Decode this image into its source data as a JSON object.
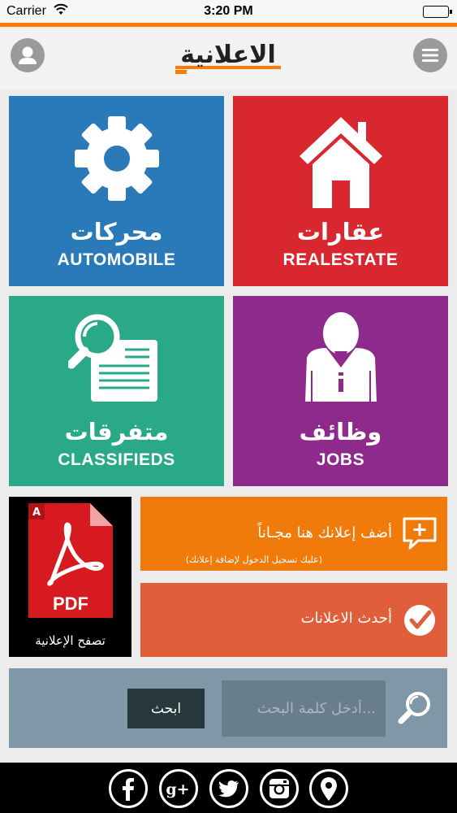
{
  "status_bar": {
    "carrier": "Carrier",
    "time": "3:20 PM"
  },
  "header": {
    "logo_text": "الاعلانية"
  },
  "tiles": [
    {
      "id": "automobile",
      "label_ar": "محركات",
      "label_en": "AUTOMOBILE",
      "color": "#2a7ab9",
      "icon": "gear-icon"
    },
    {
      "id": "realestate",
      "label_ar": "عقارات",
      "label_en": "REALESTATE",
      "color": "#d9272f",
      "icon": "house-icon"
    },
    {
      "id": "classifieds",
      "label_ar": "متفرقات",
      "label_en": "CLASSIFIEDS",
      "color": "#2aa989",
      "icon": "newspaper-search-icon"
    },
    {
      "id": "jobs",
      "label_ar": "وظائف",
      "label_en": "JOBS",
      "color": "#8e2a8b",
      "icon": "businessman-icon"
    }
  ],
  "pdf": {
    "icon_text": "PDF",
    "label": "تصفح الإعلانية"
  },
  "add_ad": {
    "title": "أضف إعلانك هنا مجـاناً",
    "subtitle": "(عليك تسجيل الدخول لإضافة إعلانك)",
    "color": "#f07b0a"
  },
  "latest": {
    "title": "أحدث الاعلانات",
    "color": "#e05f3a"
  },
  "search": {
    "placeholder": "أدخل كلمة البحث...",
    "button_label": "ابحث"
  },
  "social": [
    "facebook-icon",
    "google-plus-icon",
    "twitter-icon",
    "instagram-icon",
    "location-pin-icon"
  ]
}
